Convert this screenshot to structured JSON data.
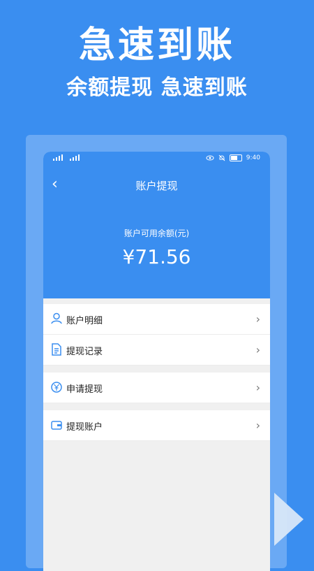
{
  "promo": {
    "title": "急速到账",
    "subtitle": "余额提现 急速到账"
  },
  "status_bar": {
    "time": "9:40"
  },
  "screen": {
    "nav_title": "账户提现",
    "back_icon": "chevron-left-icon",
    "balance_label": "账户可用余额(元)",
    "balance_amount": "¥71.56"
  },
  "menu": {
    "items": [
      {
        "label": "账户明细",
        "icon": "user-icon"
      },
      {
        "label": "提现记录",
        "icon": "document-icon"
      },
      {
        "label": "申请提现",
        "icon": "yen-circle-icon"
      },
      {
        "label": "提现账户",
        "icon": "wallet-icon"
      }
    ]
  },
  "colors": {
    "brand_blue": "#3a8ef0",
    "frame_blue": "#6aa9f4",
    "list_bg": "#f0f0f0"
  }
}
